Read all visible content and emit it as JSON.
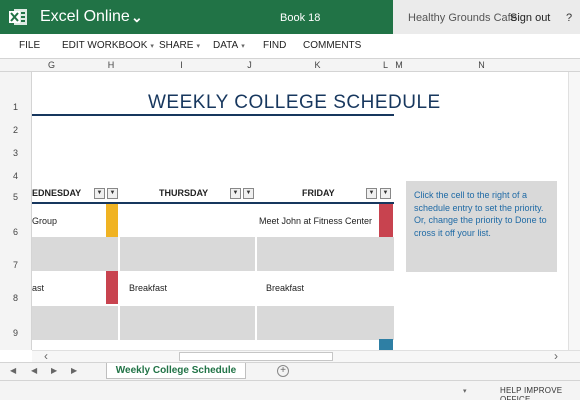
{
  "titlebar": {
    "app_name": "Excel Online",
    "book_name": "Book 18",
    "user_name": "Healthy Grounds Cafe",
    "signout": "Sign out",
    "help": "?"
  },
  "menu": [
    {
      "label": "FILE",
      "caret": false
    },
    {
      "label": "EDIT WORKBOOK",
      "caret": true
    },
    {
      "label": "SHARE",
      "caret": true
    },
    {
      "label": "DATA",
      "caret": true
    },
    {
      "label": "FIND",
      "caret": false
    },
    {
      "label": "COMMENTS",
      "caret": false
    }
  ],
  "column_headers": [
    "G",
    "H",
    "I",
    "J",
    "K",
    "L",
    "M",
    "N"
  ],
  "row_headers": [
    "1",
    "2",
    "3",
    "4",
    "5",
    "6",
    "7",
    "8",
    "9"
  ],
  "sheet": {
    "title": "WEEKLY COLLEGE SCHEDULE",
    "day_headers": [
      "EDNESDAY",
      "THURSDAY",
      "FRIDAY"
    ],
    "rows": [
      {
        "wednesday": "Group",
        "thursday": "",
        "friday": "Meet John at Fitness Center"
      },
      {
        "wednesday": "ast",
        "thursday": "Breakfast",
        "friday": "Breakfast"
      }
    ],
    "note": "Click the cell to the right of a schedule entry to set the priority. Or, change the priority to Done to cross it off your list."
  },
  "colors": {
    "brand_green": "#217346",
    "title_navy": "#17375e",
    "priority_yellow": "#f0b323",
    "priority_red": "#c8434f",
    "priority_teal": "#2e7fa4",
    "note_text": "#1f6aa5"
  },
  "sheet_tabs": {
    "active": "Weekly College Schedule"
  },
  "status": {
    "help_improve": "HELP IMPROVE OFFICE"
  }
}
